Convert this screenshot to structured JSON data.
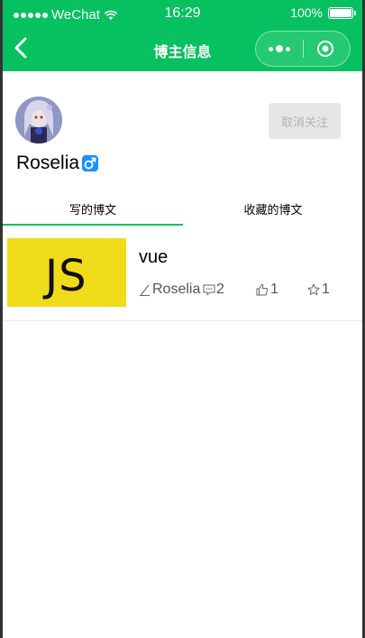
{
  "status_bar": {
    "carrier": "WeChat",
    "time": "16:29",
    "battery": "100%"
  },
  "nav": {
    "title": "博主信息"
  },
  "profile": {
    "username": "Roselia",
    "gender_icon": "male-icon",
    "unfollow_label": "取消关注"
  },
  "tabs": [
    {
      "label": "写的博文",
      "active": true
    },
    {
      "label": "收藏的博文",
      "active": false
    }
  ],
  "posts": [
    {
      "thumbnail_text": "JS",
      "title": "vue",
      "author": "Roselia",
      "comments": "2",
      "likes": "1",
      "stars": "1"
    }
  ],
  "colors": {
    "accent": "#07c160",
    "thumbnail_bg": "#f0db1a",
    "gender_blue": "#1e90ff"
  }
}
